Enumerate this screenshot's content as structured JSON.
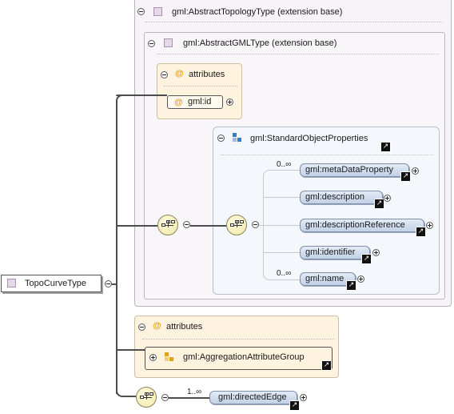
{
  "diagram": {
    "root_element": "TopoCurveType",
    "ext_outer_label": "gml:AbstractTopologyType (extension base)",
    "ext_inner_label": "gml:AbstractGMLType (extension base)",
    "inner_attributes": {
      "title": "attributes",
      "items": [
        "gml:id"
      ]
    },
    "group": {
      "name": "gml:StandardObjectProperties",
      "elements": [
        {
          "name": "gml:metaDataProperty",
          "cardinality": "0..∞"
        },
        {
          "name": "gml:description",
          "cardinality": ""
        },
        {
          "name": "gml:descriptionReference",
          "cardinality": ""
        },
        {
          "name": "gml:identifier",
          "cardinality": ""
        },
        {
          "name": "gml:name",
          "cardinality": "0..∞"
        }
      ]
    },
    "outer_attributes": {
      "title": "attributes",
      "group": "gml:AggregationAttributeGroup"
    },
    "directed_edge": {
      "name": "gml:directedEdge",
      "cardinality": "1..∞"
    },
    "ref_arrow_glyph": "↗",
    "colors": {
      "extension_bg": "#f7f3f8",
      "attribute_bg": "#fdf3df",
      "element_fill": "#c2d1e6",
      "sequence_fill": "#f2e7a3"
    }
  }
}
